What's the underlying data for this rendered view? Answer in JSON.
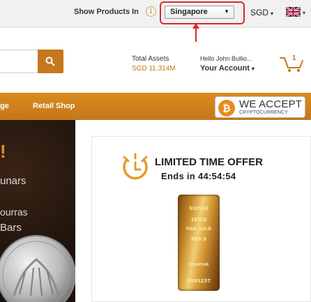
{
  "topbar": {
    "show_label": "Show Products In",
    "info_glyph": "i",
    "country_selected": "Singapore",
    "currency": "SGD",
    "caret": "▾",
    "select_caret": "▼",
    "highlight_color": "#e0262b"
  },
  "header": {
    "assets_label": "Total Assets",
    "assets_value": "SGD 11.314M",
    "greeting": "Hello John Bullio...",
    "account_label": "Your Account",
    "cart_count": "1",
    "accent_color": "#c5781c"
  },
  "nav": {
    "items": [
      "ge",
      "Retail Shop"
    ],
    "accept_title": "WE ACCEPT",
    "accept_sub": "CRYPTOCURRENCY",
    "bitcoin_glyph": "₿"
  },
  "hero": {
    "excl": "!",
    "line1": "unars",
    "line2": "ourras",
    "line3": "Bars"
  },
  "offer": {
    "title": "LIMITED TIME OFFER",
    "ends": "Ends in 44:54:54",
    "bar_lines": [
      "SUISSE",
      "1KILO",
      "FINE GOLD",
      "999.9",
      "ESSAYEUR",
      "C895237"
    ]
  },
  "icons": {
    "search": "search-icon",
    "info": "info-icon",
    "flag": "uk-flag-icon",
    "cart": "cart-icon",
    "timer": "timer-icon",
    "bitcoin": "bitcoin-icon"
  }
}
